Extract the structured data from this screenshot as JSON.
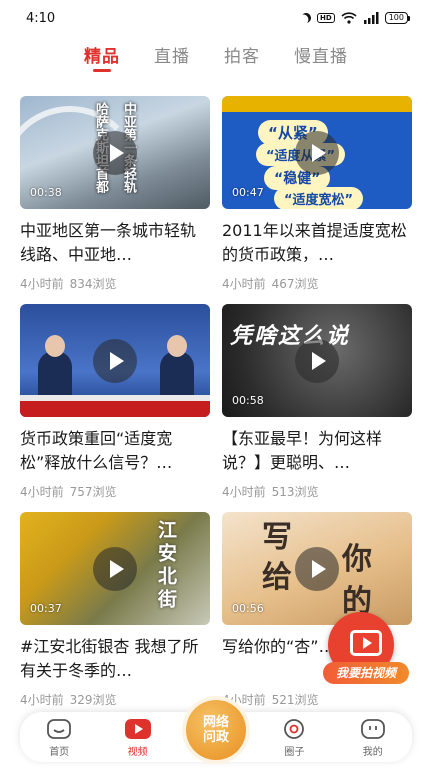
{
  "status_bar": {
    "time": "4:10",
    "hd": "HD",
    "battery": "100"
  },
  "tabs": [
    {
      "label": "精品",
      "active": true
    },
    {
      "label": "直播",
      "active": false
    },
    {
      "label": "拍客",
      "active": false
    },
    {
      "label": "慢直播",
      "active": false
    }
  ],
  "videos": [
    {
      "title": "中亚地区第一条城市轻轨线路、中亚地…",
      "time": "4小时前",
      "views": "834浏览",
      "duration": "00:38",
      "thumb_text": [
        "哈萨克斯坦首都",
        "中亚第一条轻轨"
      ]
    },
    {
      "title": "2011年以来首提适度宽松的货币政策，…",
      "time": "4小时前",
      "views": "467浏览",
      "duration": "00:47",
      "thumb_text": [
        "“从紧”",
        "“适度从紧”",
        "“稳健”",
        "“适度宽松”"
      ]
    },
    {
      "title": "货币政策重回“适度宽松”释放什么信号？…",
      "time": "4小时前",
      "views": "757浏览",
      "duration": "",
      "thumb_text": []
    },
    {
      "title": "【东亚最早！为何这样说？】更聪明、…",
      "time": "4小时前",
      "views": "513浏览",
      "duration": "00:58",
      "thumb_text": [
        "凭啥这么说"
      ]
    },
    {
      "title": "#江安北街银杏 我想了所有关于冬季的…",
      "time": "4小时前",
      "views": "329浏览",
      "duration": "00:37",
      "thumb_text": [
        "江安北街"
      ]
    },
    {
      "title": "写给你的“杏”…",
      "time": "4小时前",
      "views": "521浏览",
      "duration": "00:56",
      "thumb_text": [
        "写",
        "给",
        "你",
        "的"
      ]
    }
  ],
  "float_action": {
    "label": "我要拍视频"
  },
  "bottom_nav": [
    {
      "label": "首页",
      "icon": "home-icon",
      "active": false
    },
    {
      "label": "视频",
      "icon": "play-video-icon",
      "active": true
    },
    {
      "label": "圈子",
      "icon": "circle-icon",
      "active": false
    },
    {
      "label": "我的",
      "icon": "profile-icon",
      "active": false
    }
  ],
  "center_nav": {
    "label": "网络问政"
  },
  "colors": {
    "accent": "#e0322d",
    "float_orange": "#f08b2b",
    "center_gold": "#e98f1f"
  }
}
